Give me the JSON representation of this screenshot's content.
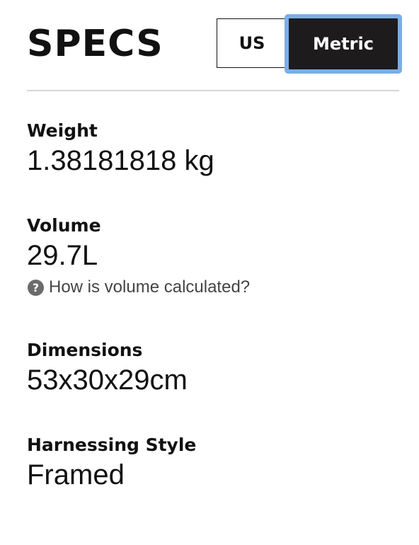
{
  "header": {
    "title": "SPECS",
    "unit_toggle": {
      "options": [
        "US",
        "Metric"
      ],
      "selected": "Metric",
      "us_label": "US",
      "metric_label": "Metric"
    }
  },
  "specs": {
    "weight": {
      "label": "Weight",
      "value": "1.38181818 kg"
    },
    "volume": {
      "label": "Volume",
      "value": "29.7L",
      "help_text": "How is volume calculated?",
      "help_icon": "question-circle-icon"
    },
    "dimensions": {
      "label": "Dimensions",
      "value": "53x30x29cm"
    },
    "harnessing_style": {
      "label": "Harnessing Style",
      "value": "Framed"
    }
  },
  "colors": {
    "text": "#111111",
    "selected_bg": "#1d1b1c",
    "focus_ring": "#7aaee6",
    "divider": "#d6d6d6",
    "help_icon_bg": "#6b6b6b"
  }
}
